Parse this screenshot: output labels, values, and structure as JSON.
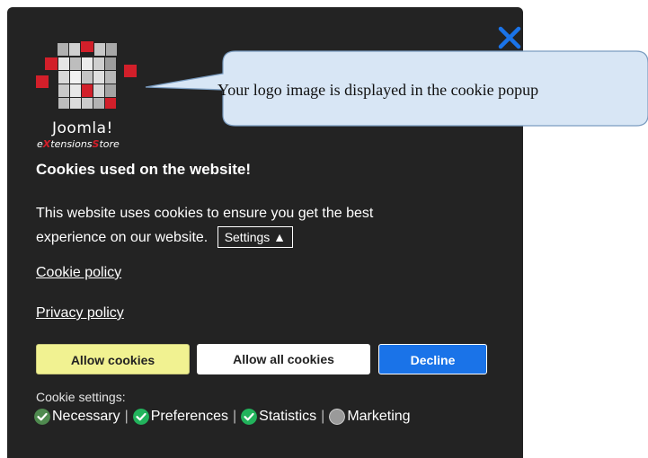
{
  "popup": {
    "close_label": "×",
    "logo": {
      "name": "Joomla!",
      "subtitle_prefix": "e",
      "subtitle_x": "X",
      "subtitle_mid": "tensions",
      "subtitle_s": "S",
      "subtitle_end": "tore"
    },
    "title": "Cookies used on the website!",
    "description": "This website uses cookies to ensure you get the best experience on our website.",
    "settings_button": "Settings ▲",
    "cookie_policy_link": "Cookie policy",
    "privacy_policy_link": "Privacy policy",
    "buttons": {
      "allow": "Allow cookies",
      "allow_all": "Allow all cookies",
      "decline": "Decline"
    },
    "cookie_settings_label": "Cookie settings:",
    "categories": [
      {
        "label": "Necessary",
        "checked": true,
        "disabled": true
      },
      {
        "label": "Preferences",
        "checked": true,
        "disabled": false
      },
      {
        "label": "Statistics",
        "checked": true,
        "disabled": false
      },
      {
        "label": "Marketing",
        "checked": false,
        "disabled": false
      }
    ]
  },
  "callout": {
    "text": "Your logo image is displayed in the cookie popup"
  },
  "colors": {
    "popup_bg": "#232323",
    "allow_bg": "#f1f291",
    "decline_bg": "#1a73e8",
    "close_icon": "#1a73e8",
    "check_green": "#22b35c",
    "check_disabled": "#4f8a4f",
    "callout_bg": "#d8e6f5"
  }
}
